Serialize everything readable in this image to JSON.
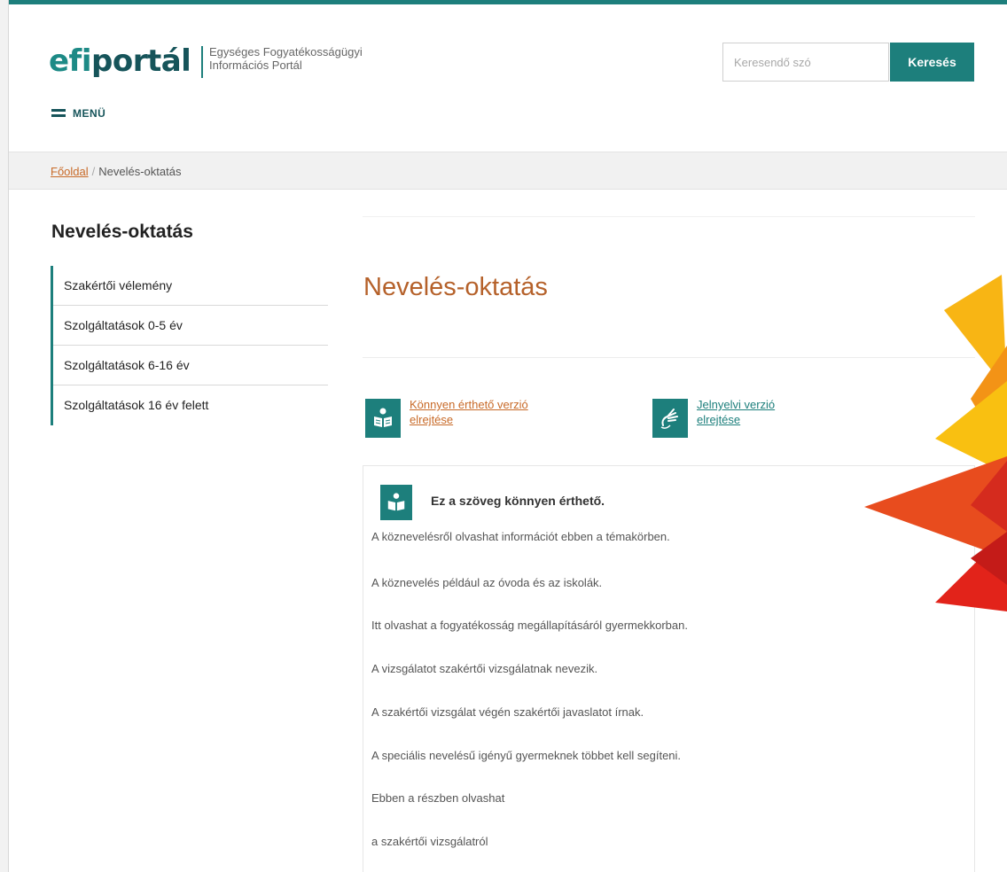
{
  "header": {
    "logo_efi": "efi",
    "logo_portal": "portál",
    "logo_subtitle_line1": "Egységes Fogyatékosságügyi",
    "logo_subtitle_line2": "Információs Portál",
    "search_placeholder": "Keresendő szó",
    "search_button": "Keresés",
    "menu_label": "MENÜ"
  },
  "breadcrumb": {
    "home": "Főoldal",
    "separator": "/",
    "current": "Nevelés-oktatás"
  },
  "sidebar": {
    "title": "Nevelés-oktatás",
    "items": [
      {
        "label": "Szakértői vélemény"
      },
      {
        "label": "Szolgáltatások 0-5 év"
      },
      {
        "label": "Szolgáltatások 6-16 év"
      },
      {
        "label": "Szolgáltatások 16 év felett"
      }
    ]
  },
  "main": {
    "title": "Nevelés-oktatás",
    "easy_version_link_line1": "Könnyen érthető verzió",
    "easy_version_link_line2": "elrejtése",
    "sign_version_link_line1": "Jelnyelvi verzió",
    "sign_version_link_line2": "elrejtése",
    "easy_heading": "Ez a szöveg könnyen érthető.",
    "paragraphs": [
      "A köznevelésről olvashat információt ebben a témakörben.",
      "A köznevelés például az óvoda és az iskolák.",
      "Itt olvashat a fogyatékosság megállapításáról gyermekkorban.",
      "A vizsgálatot szakértői vizsgálatnak nevezik.",
      "A szakértői vizsgálat végén szakértői javaslatot írnak.",
      "A speciális nevelésű igényű gyermeknek többet kell segíteni.",
      "Ebben a részben olvashat",
      "a szakértői vizsgálatról"
    ]
  },
  "colors": {
    "brand_teal": "#1d7f7c",
    "title_orange": "#b5612a",
    "link_orange": "#c86a28"
  },
  "icons": {
    "menu": "hamburger-icon",
    "easy_read": "book-reader-icon",
    "sign_language": "sign-hand-icon"
  }
}
